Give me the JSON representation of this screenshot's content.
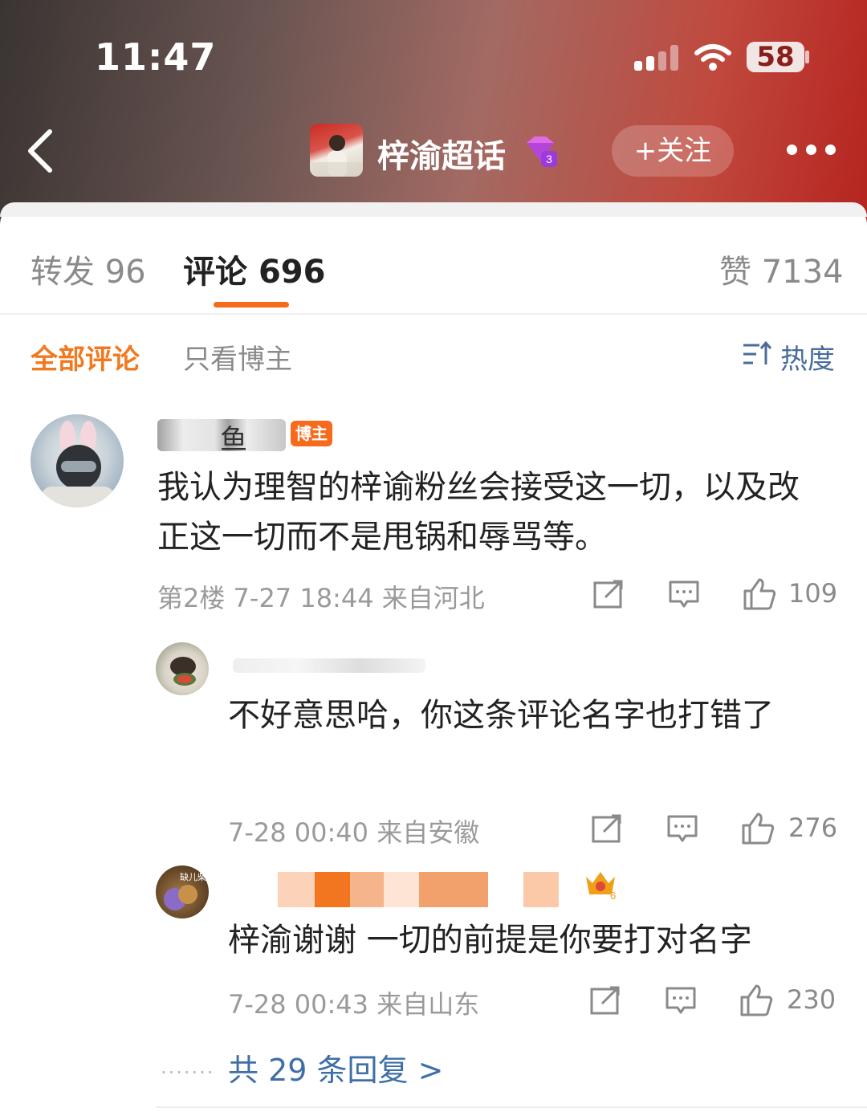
{
  "status_bar": {
    "time": "11:47",
    "battery": "58"
  },
  "topbar": {
    "title": "梓渝超话",
    "follow_label": "+关注"
  },
  "tabs": [
    {
      "label": "转发",
      "count": "96"
    },
    {
      "label": "评论",
      "count": "696"
    },
    {
      "label": "赞",
      "count": "7134"
    }
  ],
  "filters": {
    "all": "全部评论",
    "host_only": "只看博主",
    "sort": "热度"
  },
  "comment": {
    "username_visible": "鱼",
    "badge": "博主",
    "text": "我认为理智的梓谕粉丝会接受这一切，以及改正这一切而不是甩锅和辱骂等。",
    "meta": "第2楼 7-27 18:44 来自河北",
    "likes": "109"
  },
  "replies": [
    {
      "text": "不好意思哈，你这条评论名字也打错了",
      "meta": "7-28 00:40 来自安徽",
      "likes": "276"
    },
    {
      "avatar_text": "缺儿柴",
      "text": "梓渝谢谢 一切的前提是你要打对名字",
      "meta": "7-28 00:43 来自山东",
      "likes": "230"
    }
  ],
  "more_replies": "共 29 条回复 >",
  "colors": {
    "accent": "#f56b1b",
    "link": "#3f6fa6"
  }
}
